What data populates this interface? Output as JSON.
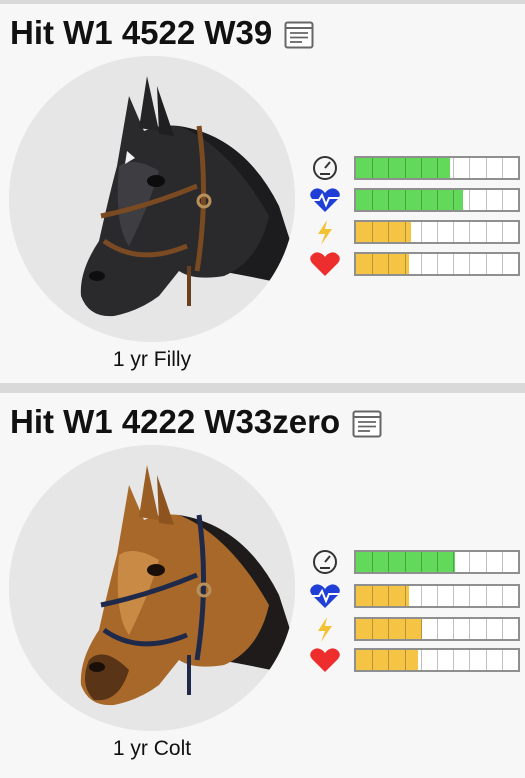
{
  "horses": [
    {
      "name": "Hit W1 4522 W39",
      "age_label": "1 yr Filly",
      "coat": "black",
      "stats": [
        {
          "icon": "speedometer-icon",
          "level": 0.58,
          "color": "#62d95a"
        },
        {
          "icon": "heartbeat-icon",
          "level": 0.66,
          "color": "#62d95a"
        },
        {
          "icon": "lightning-icon",
          "level": 0.34,
          "color": "#f6c444"
        },
        {
          "icon": "heart-icon",
          "level": 0.33,
          "color": "#f6c444"
        }
      ]
    },
    {
      "name": "Hit W1 4222 W33zero",
      "age_label": "1 yr Colt",
      "coat": "bay",
      "stats": [
        {
          "icon": "speedometer-icon",
          "level": 0.61,
          "color": "#62d95a"
        },
        {
          "icon": "heartbeat-icon",
          "level": 0.33,
          "color": "#f6c444"
        },
        {
          "icon": "lightning-icon",
          "level": 0.41,
          "color": "#f6c444"
        },
        {
          "icon": "heart-icon",
          "level": 0.38,
          "color": "#f6c444"
        }
      ]
    }
  ]
}
